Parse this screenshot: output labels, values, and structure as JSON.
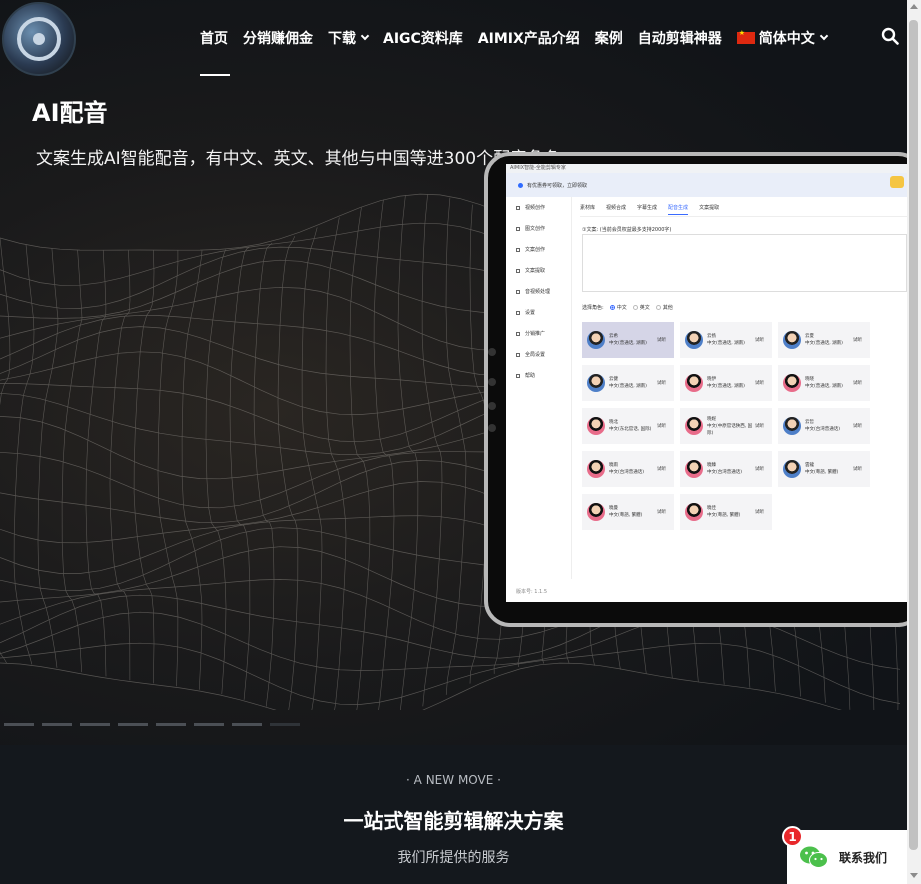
{
  "nav": {
    "items": [
      {
        "label": "首页",
        "dropdown": false
      },
      {
        "label": "分销赚佣金",
        "dropdown": false
      },
      {
        "label": "下载",
        "dropdown": true
      },
      {
        "label": "AIGC资料库",
        "dropdown": false
      },
      {
        "label": "AIMIX产品介绍",
        "dropdown": false
      },
      {
        "label": "案例",
        "dropdown": false
      },
      {
        "label": "自动剪辑神器",
        "dropdown": false
      }
    ],
    "language": "简体中文",
    "active_index": 0
  },
  "hero": {
    "title": "AI配音",
    "subtitle": "文案生成AI智能配音，有中文、英文、其他与中国等进300个配音角色"
  },
  "app": {
    "window_title": "AIMIX智能-全能剪辑专家",
    "banner": "有优惠券可领取，立即领取",
    "sidebar": [
      "视频创作",
      "图文创作",
      "文案创作",
      "文案提取",
      "音视频处理",
      "设置",
      "分销推广",
      "全局设置",
      "帮助"
    ],
    "tabs": [
      "素材库",
      "视频合成",
      "字幕生成",
      "配音生成",
      "文案提取"
    ],
    "active_tab": 3,
    "text_label": "①文案: (当前会员权益最多支持2000字)",
    "role_label": "选择角色:",
    "radios": [
      "中文",
      "英文",
      "其他"
    ],
    "voices": [
      {
        "name": "云希",
        "desc": "中文(普通话, 湖南)",
        "try": "试听",
        "gender": "m",
        "selected": true
      },
      {
        "name": "云扬",
        "desc": "中文(普通话, 湖南)",
        "try": "试听",
        "gender": "m"
      },
      {
        "name": "云夏",
        "desc": "中文(普通话, 湖南)",
        "try": "试听",
        "gender": "m"
      },
      {
        "name": "云健",
        "desc": "中文(普通话, 湖南)",
        "try": "试听",
        "gender": "m"
      },
      {
        "name": "晓伊",
        "desc": "中文(普通话, 湖南)",
        "try": "试听",
        "gender": "f"
      },
      {
        "name": "晓晓",
        "desc": "中文(普通话, 湖南)",
        "try": "试听",
        "gender": "f"
      },
      {
        "name": "晓北",
        "desc": "中文(东北官话, 国际)",
        "try": "试听",
        "gender": "f"
      },
      {
        "name": "晓妮",
        "desc": "中文(中原官话陕西, 国际)",
        "try": "试听",
        "gender": "f"
      },
      {
        "name": "云哲",
        "desc": "中文(台湾普通话)",
        "try": "试听",
        "gender": "m"
      },
      {
        "name": "曉雨",
        "desc": "中文(台湾普通话)",
        "try": "试听",
        "gender": "f"
      },
      {
        "name": "曉臻",
        "desc": "中文(台湾普通话)",
        "try": "试听",
        "gender": "f"
      },
      {
        "name": "雲龍",
        "desc": "中文(粵語, 繁體)",
        "try": "试听",
        "gender": "m"
      },
      {
        "name": "曉曼",
        "desc": "中文(粵語, 繁體)",
        "try": "试听",
        "gender": "f"
      },
      {
        "name": "曉佳",
        "desc": "中文(粵語, 繁體)",
        "try": "试听",
        "gender": "f"
      }
    ],
    "version": "版本号: 1.1.5"
  },
  "carousel": {
    "count": 8,
    "active_index": 7
  },
  "section": {
    "eyebrow": "· A NEW MOVE ·",
    "title": "一站式智能剪辑解决方案",
    "subtitle": "我们所提供的服务"
  },
  "contact": {
    "label": "联系我们",
    "badge": "1"
  },
  "colors": {
    "accent": "#3a6bff",
    "badge": "#e8282b",
    "background": "#14181d"
  }
}
